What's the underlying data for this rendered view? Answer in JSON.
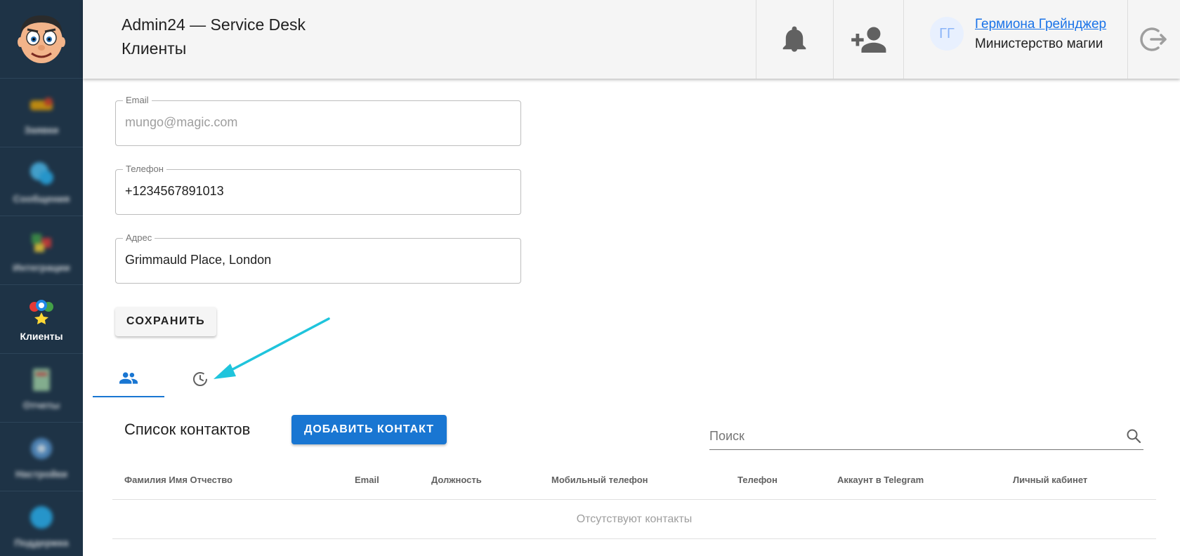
{
  "header": {
    "app_title": "Admin24 — Service Desk",
    "page_title": "Клиенты",
    "user": {
      "initials": "ГГ",
      "name": "Гермиона Грейнджер",
      "organization": "Министерство магии"
    }
  },
  "sidebar": {
    "items": [
      {
        "label": "Заявки",
        "icon": "tickets-icon"
      },
      {
        "label": "Сообщения",
        "icon": "messages-icon"
      },
      {
        "label": "Интеграции",
        "icon": "integrations-icon"
      },
      {
        "label": "Клиенты",
        "icon": "clients-icon"
      },
      {
        "label": "Отчеты",
        "icon": "reports-icon"
      },
      {
        "label": "Настройки",
        "icon": "settings-icon"
      },
      {
        "label": "Поддержка",
        "icon": "support-icon"
      }
    ]
  },
  "form": {
    "email": {
      "label": "Email",
      "value": "mungo@magic.com"
    },
    "phone": {
      "label": "Телефон",
      "value": "+1234567891013"
    },
    "address": {
      "label": "Адрес",
      "value": "Grimmauld Place, London"
    },
    "save_label": "СОХРАНИТЬ"
  },
  "tabs": [
    {
      "icon": "people-icon",
      "active": true
    },
    {
      "icon": "history-icon",
      "active": false
    }
  ],
  "contacts": {
    "title": "Список контактов",
    "add_label": "ДОБАВИТЬ КОНТАКТ",
    "search_placeholder": "Поиск",
    "columns": [
      "Фамилия Имя Отчество",
      "Email",
      "Должность",
      "Мобильный телефон",
      "Телефон",
      "Аккаунт в Telegram",
      "Личный кабинет"
    ],
    "empty_text": "Отсутствуют контакты"
  },
  "colors": {
    "sidebar_bg": "#1e3346",
    "accent": "#1976d2",
    "annotation_arrow": "#1fc4dc"
  }
}
